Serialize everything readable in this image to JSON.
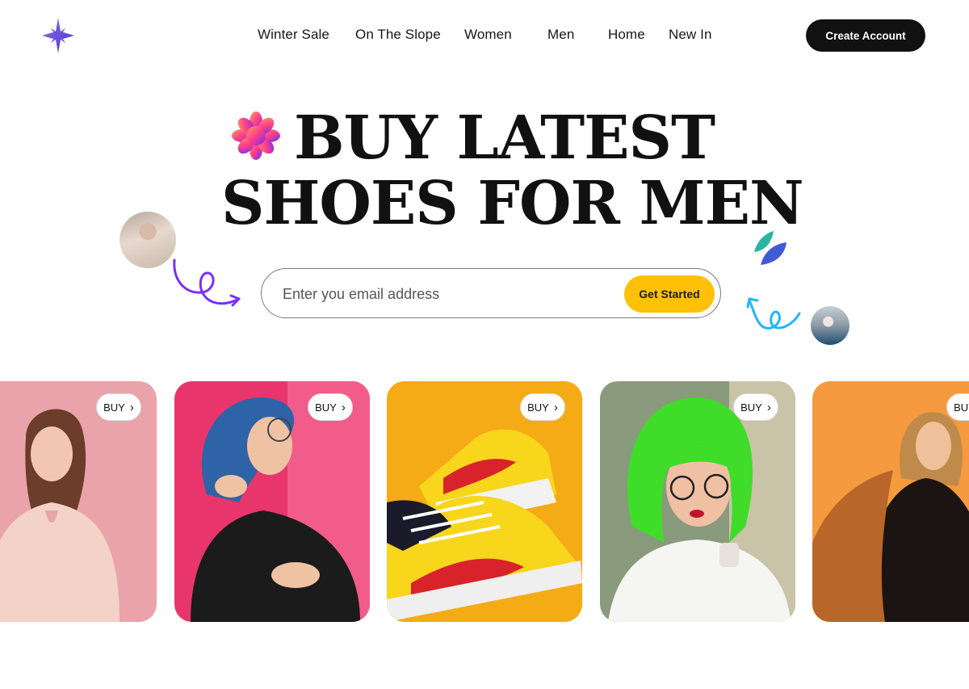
{
  "nav": {
    "items": [
      "Winter Sale",
      "On The Slope",
      "Women",
      "Men",
      "Home",
      "New In"
    ],
    "cta_label": "Create Account"
  },
  "hero": {
    "line1": "BUY LATEST",
    "line2": "SHOES FOR MEN"
  },
  "signup": {
    "placeholder": "Enter you email address",
    "button_label": "Get Started"
  },
  "cards": [
    {
      "buy_label": "BUY",
      "subject": "woman in pink blouse"
    },
    {
      "buy_label": "BUY",
      "subject": "blue-haired woman with glasses"
    },
    {
      "buy_label": "BUY",
      "subject": "yellow red and black sneakers"
    },
    {
      "buy_label": "BUY",
      "subject": "green-haired woman with glasses"
    },
    {
      "buy_label": "BUY",
      "subject": "woman in orange jacket"
    }
  ],
  "colors": {
    "accent": "#ffc107",
    "dark": "#111111",
    "logo_purple": "#6c4fd8",
    "squiggle_purple": "#7b2ff7",
    "squiggle_blue": "#1fb6ff",
    "leaf_teal": "#2bb5a0",
    "leaf_blue": "#3f5bd6"
  }
}
